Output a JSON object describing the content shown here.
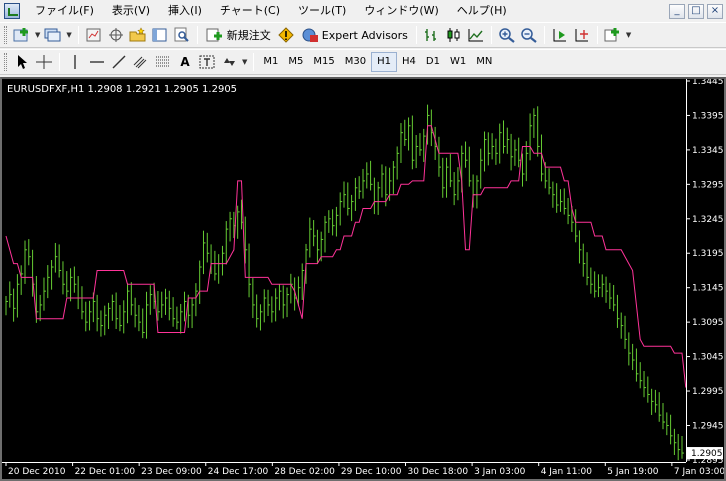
{
  "menu": {
    "items": [
      "ファイル(F)",
      "表示(V)",
      "挿入(I)",
      "チャート(C)",
      "ツール(T)",
      "ウィンドウ(W)",
      "ヘルプ(H)"
    ],
    "window_buttons": [
      "_",
      "□",
      "×"
    ]
  },
  "toolbar": {
    "new_order_label": "新規注文",
    "expert_advisors_label": "Expert Advisors",
    "text_tool_label": "A"
  },
  "timeframes": [
    "M1",
    "M5",
    "M15",
    "M30",
    "H1",
    "H4",
    "D1",
    "W1",
    "MN"
  ],
  "active_timeframe": "H1",
  "chart": {
    "info": "EURUSDFXF,H1  1.2908 1.2921 1.2905 1.2905",
    "current_price_label": "1.2905",
    "colors": {
      "background": "#000000",
      "candles": "#66cc33",
      "indicator": "#ff3399",
      "axis_text": "#ffffff"
    }
  },
  "chart_data": {
    "type": "line",
    "symbol": "EURUSDFXF",
    "timeframe": "H1",
    "ohlc": {
      "open": 1.2908,
      "high": 1.2921,
      "low": 1.2905,
      "close": 1.2905
    },
    "x_tick_labels": [
      "20 Dec 2010",
      "22 Dec 01:00",
      "23 Dec 09:00",
      "24 Dec 17:00",
      "28 Dec 02:00",
      "29 Dec 10:00",
      "30 Dec 18:00",
      "3 Jan 03:00",
      "4 Jan 11:00",
      "5 Jan 19:00",
      "7 Jan 03:00"
    ],
    "y_tick_labels": [
      "1.3445",
      "1.3395",
      "1.3345",
      "1.3295",
      "1.3245",
      "1.3195",
      "1.3145",
      "1.3095",
      "1.3045",
      "1.2995",
      "1.2945",
      "1.2895"
    ],
    "ylim": [
      1.2892,
      1.3445
    ],
    "grid": false,
    "series": [
      {
        "values": [
          1.3125,
          1.3135,
          1.3115,
          1.315,
          1.3165,
          1.32,
          1.319,
          1.315,
          1.311,
          1.312,
          1.314,
          1.316,
          1.3175,
          1.319,
          1.317,
          1.315,
          1.314,
          1.316,
          1.315,
          1.313,
          1.311,
          1.3095,
          1.311,
          1.3125,
          1.31,
          1.309,
          1.3105,
          1.3115,
          1.3125,
          1.31,
          1.309,
          1.311,
          1.314,
          1.312,
          1.3105,
          1.3095,
          1.308,
          1.312,
          1.3135,
          1.3125,
          1.311,
          1.312,
          1.313,
          1.3115,
          1.31,
          1.3095,
          1.311,
          1.3125,
          1.3105,
          1.312,
          1.314,
          1.3175,
          1.321,
          1.3195,
          1.318,
          1.3165,
          1.318,
          1.3195,
          1.323,
          1.3245,
          1.3235,
          1.3255,
          1.324,
          1.32,
          1.315,
          1.312,
          1.31,
          1.311,
          1.313,
          1.312,
          1.311,
          1.313,
          1.314,
          1.312,
          1.3135,
          1.315,
          1.313,
          1.3145,
          1.317,
          1.32,
          1.323,
          1.322,
          1.32,
          1.3215,
          1.324,
          1.3245,
          1.3235,
          1.325,
          1.327,
          1.328,
          1.326,
          1.327,
          1.329,
          1.3285,
          1.33,
          1.331,
          1.3295,
          1.327,
          1.329,
          1.331,
          1.328,
          1.33,
          1.332,
          1.334,
          1.337,
          1.336,
          1.338,
          1.333,
          1.335,
          1.3345,
          1.3365,
          1.3395,
          1.337,
          1.335,
          1.332,
          1.329,
          1.332,
          1.33,
          1.328,
          1.33,
          1.334,
          1.333,
          1.33,
          1.328,
          1.33,
          1.333,
          1.336,
          1.334,
          1.335,
          1.334,
          1.337,
          1.335,
          1.336,
          1.3335,
          1.3345,
          1.333,
          1.331,
          1.334,
          1.338,
          1.3395,
          1.335,
          1.331,
          1.33,
          1.329,
          1.328,
          1.3265,
          1.327,
          1.326,
          1.325,
          1.324,
          1.322,
          1.32,
          1.318,
          1.316,
          1.315,
          1.314,
          1.3145,
          1.315,
          1.314,
          1.313,
          1.312,
          1.31,
          1.309,
          1.307,
          1.305,
          1.304,
          1.302,
          1.301,
          1.3,
          1.299,
          1.298,
          1.2975,
          1.296,
          1.295,
          1.2945,
          1.293,
          1.292,
          1.291,
          1.2905
        ]
      },
      {
        "values": [
          1.322,
          1.32,
          1.318,
          1.318,
          1.316,
          1.316,
          1.316,
          1.316,
          1.31,
          1.31,
          1.31,
          1.31,
          1.31,
          1.31,
          1.31,
          1.31,
          1.313,
          1.313,
          1.313,
          1.313,
          1.313,
          1.313,
          1.313,
          1.313,
          1.317,
          1.317,
          1.317,
          1.317,
          1.317,
          1.317,
          1.317,
          1.317,
          1.315,
          1.315,
          1.315,
          1.315,
          1.315,
          1.315,
          1.315,
          1.315,
          1.308,
          1.308,
          1.308,
          1.308,
          1.308,
          1.308,
          1.308,
          1.308,
          1.313,
          1.313,
          1.313,
          1.314,
          1.314,
          1.314,
          1.318,
          1.318,
          1.318,
          1.318,
          1.318,
          1.319,
          1.32,
          1.33,
          1.33,
          1.316,
          1.316,
          1.316,
          1.316,
          1.316,
          1.316,
          1.316,
          1.315,
          1.315,
          1.315,
          1.315,
          1.315,
          1.315,
          1.314,
          1.312,
          1.31,
          1.318,
          1.318,
          1.318,
          1.318,
          1.319,
          1.319,
          1.319,
          1.319,
          1.32,
          1.32,
          1.322,
          1.322,
          1.322,
          1.324,
          1.324,
          1.326,
          1.326,
          1.326,
          1.327,
          1.327,
          1.327,
          1.327,
          1.328,
          1.328,
          1.328,
          1.3295,
          1.3295,
          1.3295,
          1.33,
          1.33,
          1.33,
          1.33,
          1.338,
          1.338,
          1.336,
          1.334,
          1.334,
          1.334,
          1.334,
          1.334,
          1.334,
          1.33,
          1.32,
          1.32,
          1.328,
          1.328,
          1.328,
          1.329,
          1.329,
          1.329,
          1.329,
          1.329,
          1.329,
          1.329,
          1.33,
          1.33,
          1.33,
          1.335,
          1.335,
          1.335,
          1.334,
          1.334,
          1.334,
          1.332,
          1.332,
          1.332,
          1.332,
          1.332,
          1.33,
          1.33,
          1.326,
          1.324,
          1.324,
          1.324,
          1.324,
          1.324,
          1.322,
          1.322,
          1.322,
          1.32,
          1.32,
          1.32,
          1.32,
          1.32,
          1.319,
          1.318,
          1.317,
          1.312,
          1.307,
          1.306,
          1.306,
          1.306,
          1.306,
          1.306,
          1.306,
          1.306,
          1.306,
          1.305,
          1.305,
          1.305,
          1.3
        ]
      }
    ]
  }
}
